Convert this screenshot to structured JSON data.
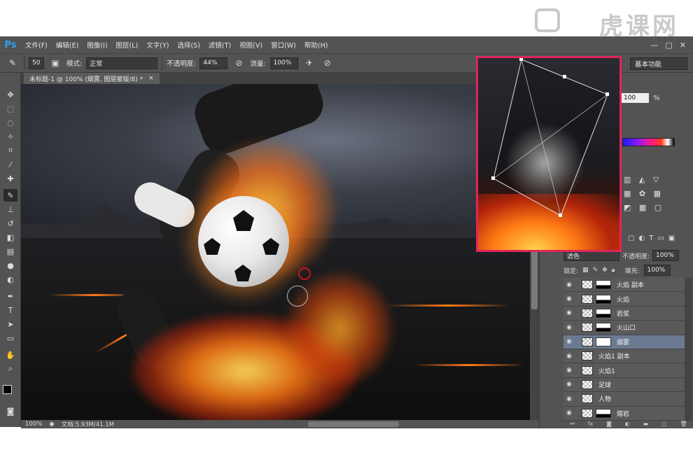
{
  "watermark": {
    "text": "虎课网"
  },
  "app": {
    "logo": "Ps"
  },
  "menu": {
    "items": [
      "文件(F)",
      "编辑(E)",
      "图像(I)",
      "图层(L)",
      "文字(Y)",
      "选择(S)",
      "滤镜(T)",
      "视图(V)",
      "窗口(W)",
      "帮助(H)"
    ]
  },
  "options": {
    "brush_size": "50",
    "mode_label": "模式:",
    "mode_value": "正常",
    "opacity_label": "不透明度:",
    "opacity_value": "44%",
    "flow_label": "流量:",
    "flow_value": "100%",
    "workspace": "基本功能"
  },
  "document": {
    "tab_title": "未标题-1 @ 100% (烟雾, 图层蒙版/8) *",
    "close": "×"
  },
  "status": {
    "zoom": "100%",
    "doc_size": "文档:5.93M/41.1M"
  },
  "color_panel": {
    "value": "100",
    "unit": "%"
  },
  "layers_panel": {
    "blend_mode": "滤色",
    "opacity_label": "不透明度:",
    "opacity_value": "100%",
    "lock_label": "锁定:",
    "fill_label": "填充:",
    "fill_value": "100%",
    "layers": [
      {
        "name": "火焰 副本",
        "has_mask": true,
        "mask_dark": true
      },
      {
        "name": "火焰",
        "has_mask": true,
        "mask_dark": true
      },
      {
        "name": "岩浆",
        "has_mask": true,
        "mask_dark": true
      },
      {
        "name": "火山口",
        "has_mask": true,
        "mask_dark": true
      },
      {
        "name": "烟雾",
        "has_mask": true,
        "mask_dark": false,
        "selected": true
      },
      {
        "name": "火焰1 副本",
        "has_mask": false
      },
      {
        "name": "火焰1",
        "has_mask": false
      },
      {
        "name": "足球",
        "has_mask": false
      },
      {
        "name": "人物",
        "has_mask": false
      },
      {
        "name": "熔岩",
        "has_mask": true,
        "mask_dark": true
      }
    ]
  },
  "icons": {
    "close": "close-icon",
    "minimize": "minimize-icon",
    "maximize": "maximize-icon",
    "brush": "brush-icon",
    "eye": "eye-icon"
  }
}
